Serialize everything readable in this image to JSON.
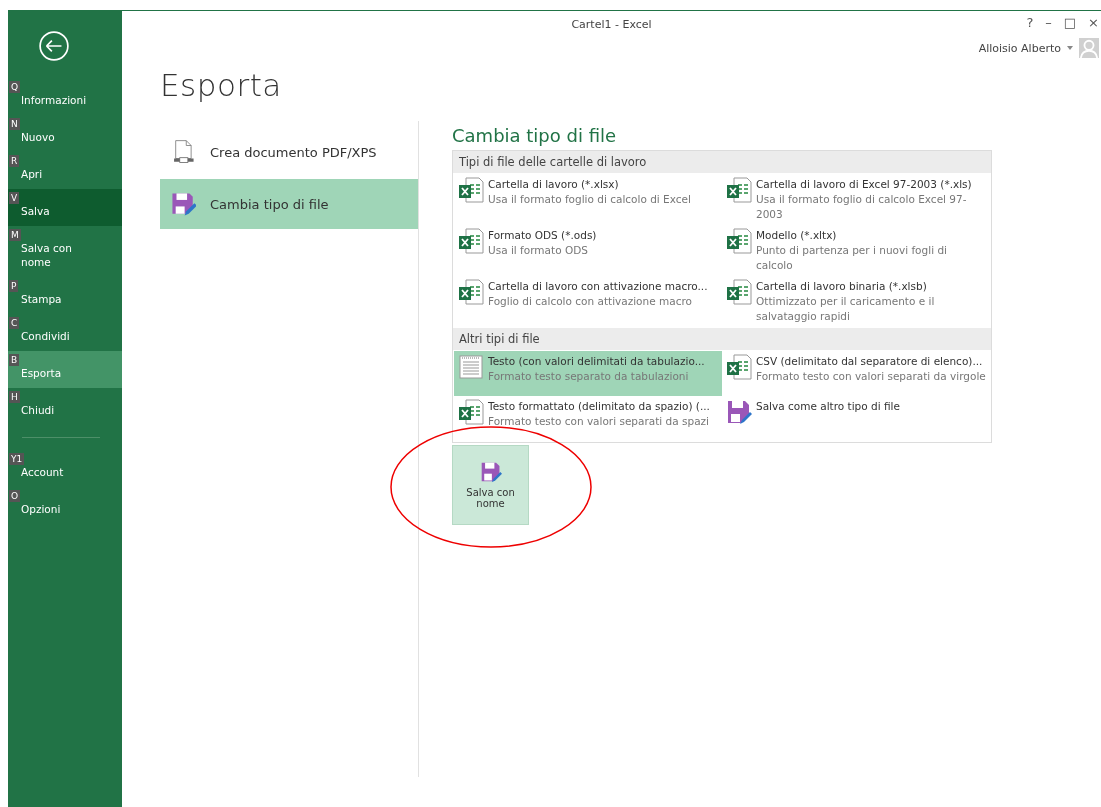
{
  "window": {
    "title": "Cartel1 - Excel",
    "controls": [
      "?",
      "–",
      "□",
      "×"
    ],
    "user": "Alloisio Alberto"
  },
  "sidebar": {
    "items": [
      {
        "label": "Informazioni",
        "key": "Q",
        "selected": false,
        "hovered": false
      },
      {
        "label": "Nuovo",
        "key": "N",
        "selected": false,
        "hovered": false
      },
      {
        "label": "Apri",
        "key": "R",
        "selected": false,
        "hovered": false
      },
      {
        "label": "Salva",
        "key": "V",
        "selected": false,
        "hovered": true
      },
      {
        "label": "Salva con nome",
        "key": "M",
        "selected": false,
        "hovered": false
      },
      {
        "label": "Stampa",
        "key": "P",
        "selected": false,
        "hovered": false
      },
      {
        "label": "Condividi",
        "key": "C",
        "selected": false,
        "hovered": false
      },
      {
        "label": "Esporta",
        "key": "B",
        "selected": true,
        "hovered": false
      },
      {
        "label": "Chiudi",
        "key": "H",
        "selected": false,
        "hovered": false
      }
    ],
    "bottom_items": [
      {
        "label": "Account",
        "key": "Y1",
        "selected": false,
        "hovered": false
      },
      {
        "label": "Opzioni",
        "key": "O",
        "selected": false,
        "hovered": false
      }
    ]
  },
  "page_title": "Esporta",
  "options": [
    {
      "label": "Crea documento PDF/XPS",
      "kind": "pdf",
      "selected": false
    },
    {
      "label": "Cambia tipo di file",
      "kind": "save",
      "selected": true
    }
  ],
  "panel": {
    "title": "Cambia tipo di file",
    "groups": [
      {
        "title": "Tipi di file delle cartelle di lavoro",
        "items": [
          {
            "name": "Cartella di lavoro (*.xlsx)",
            "description": "Usa il formato foglio di calcolo di Excel",
            "kind": "excel",
            "selected": false
          },
          {
            "name": "Cartella di lavoro di Excel 97-2003 (*.xls)",
            "description": "Usa il formato foglio di calcolo Excel 97-2003",
            "kind": "excel",
            "selected": false
          },
          {
            "name": "Formato ODS (*.ods)",
            "description": "Usa il formato ODS",
            "kind": "excel",
            "selected": false
          },
          {
            "name": "Modello (*.xltx)",
            "description": "Punto di partenza per i nuovi fogli di calcolo",
            "kind": "excel",
            "selected": false
          },
          {
            "name": "Cartella di lavoro con attivazione macro...",
            "description": "Foglio di calcolo con attivazione macro",
            "kind": "excel",
            "selected": false
          },
          {
            "name": "Cartella di lavoro binaria (*.xlsb)",
            "description": "Ottimizzato per il caricamento e il salvataggio rapidi",
            "kind": "excel",
            "selected": false
          }
        ]
      },
      {
        "title": "Altri tipi di file",
        "items": [
          {
            "name": "Testo (con valori delimitati da tabulazio...",
            "description": "Formato testo separato da tabulazioni",
            "kind": "text",
            "selected": true
          },
          {
            "name": "CSV (delimitato dal separatore di elenco)...",
            "description": "Formato testo con valori separati da virgole",
            "kind": "excel",
            "selected": false
          },
          {
            "name": "Testo formattato (delimitato da spazio) (...",
            "description": "Formato testo con valori separati da spazi",
            "kind": "excel",
            "selected": false
          },
          {
            "name": "Salva come altro tipo di file",
            "kind": "save",
            "selected": false
          }
        ]
      }
    ],
    "save_button": "Salva con nome"
  }
}
